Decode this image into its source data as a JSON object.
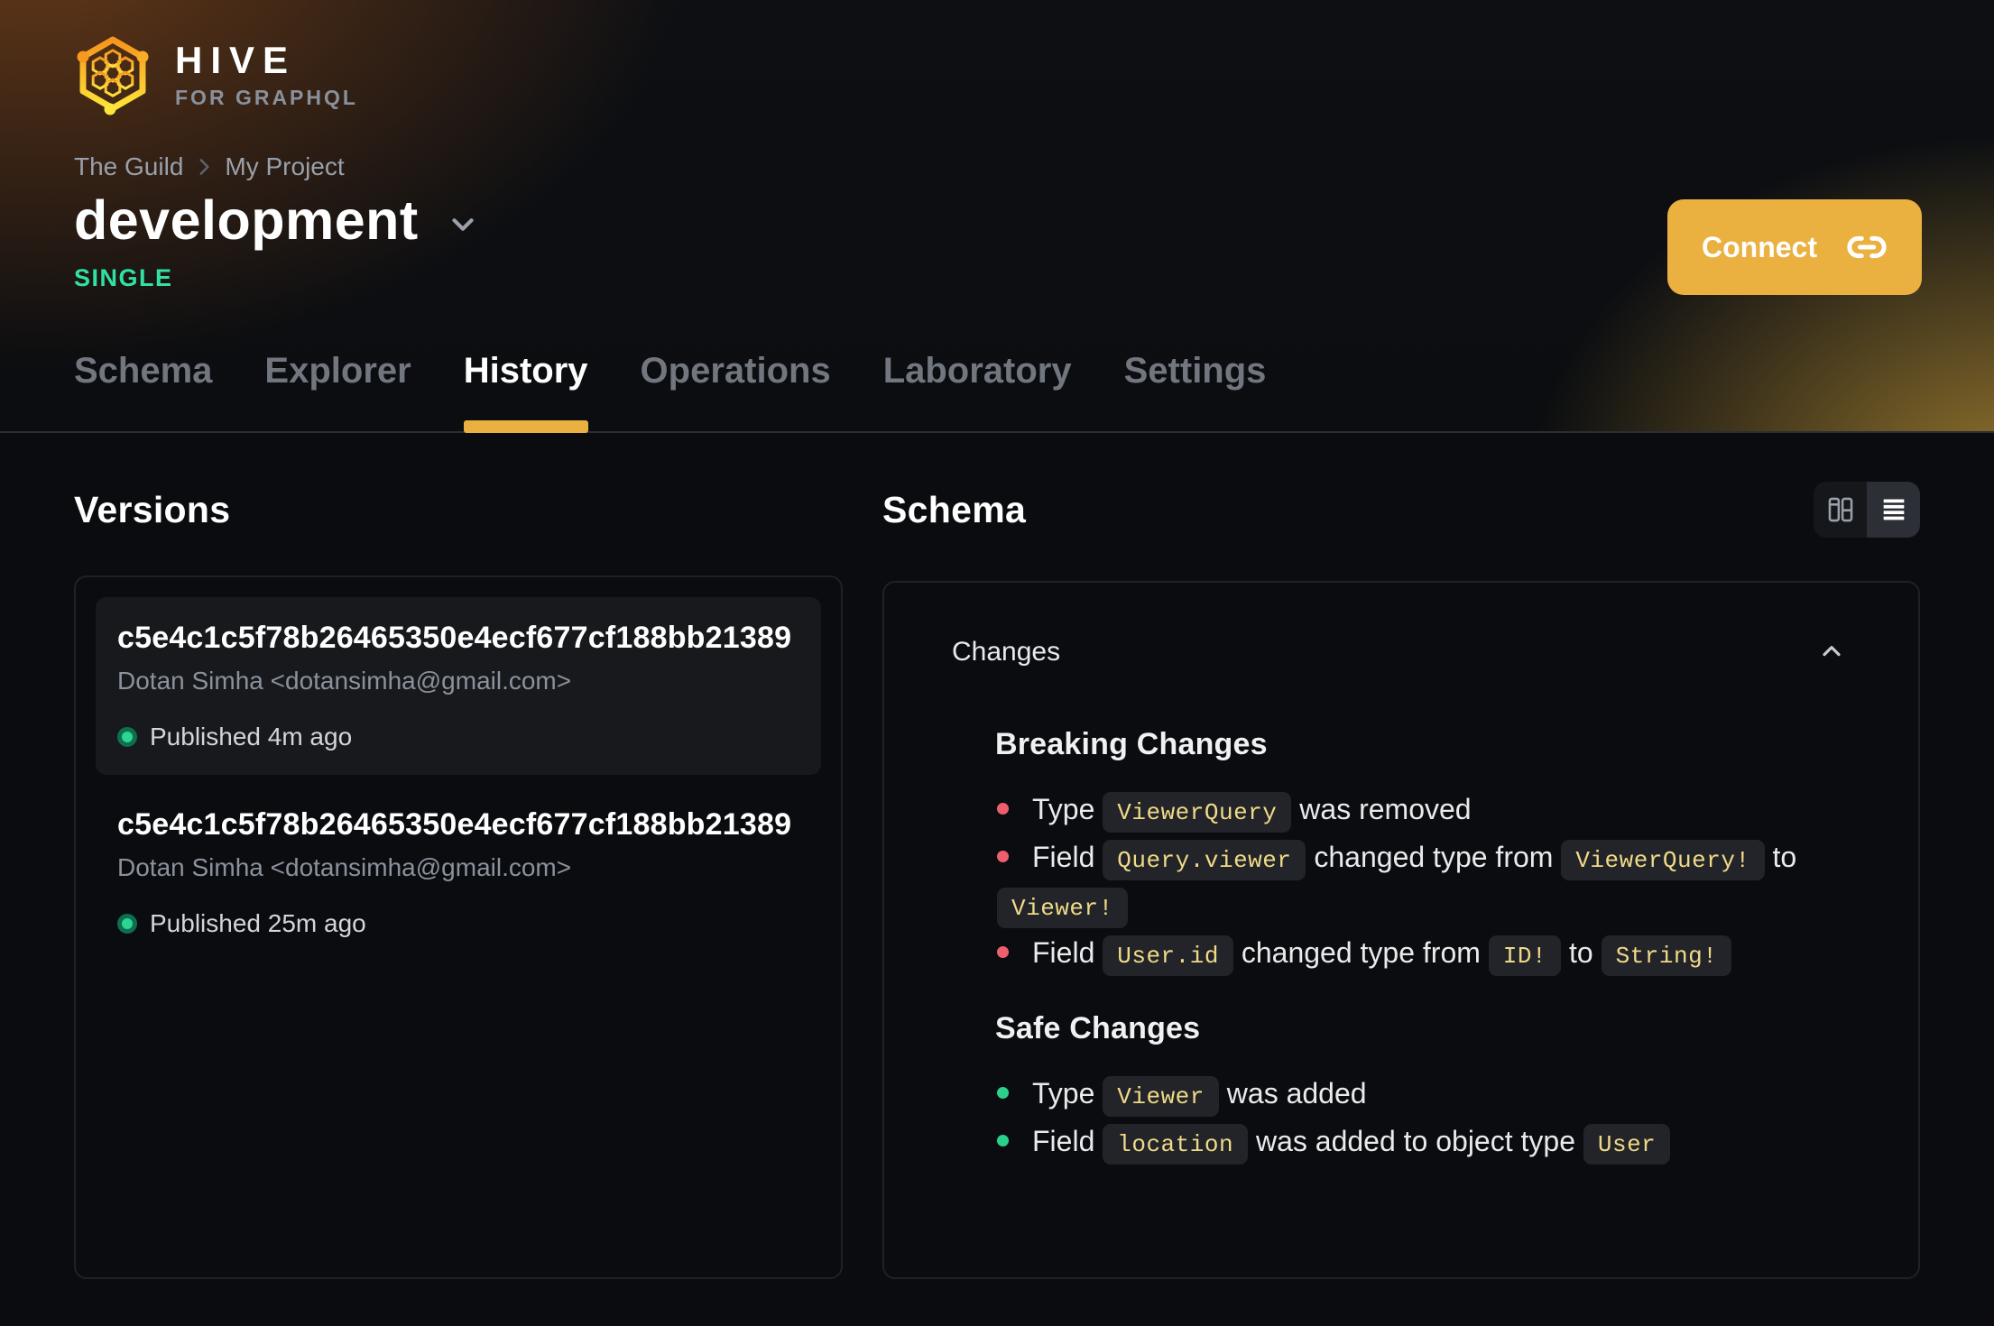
{
  "brand": {
    "name": "HIVE",
    "tagline": "FOR GRAPHQL"
  },
  "breadcrumb": [
    "The Guild",
    "My Project"
  ],
  "header": {
    "target_name": "development",
    "badge": "SINGLE",
    "connect_label": "Connect"
  },
  "tabs": [
    {
      "label": "Schema",
      "active": false
    },
    {
      "label": "Explorer",
      "active": false
    },
    {
      "label": "History",
      "active": true
    },
    {
      "label": "Operations",
      "active": false
    },
    {
      "label": "Laboratory",
      "active": false
    },
    {
      "label": "Settings",
      "active": false
    }
  ],
  "versions": {
    "title": "Versions",
    "items": [
      {
        "hash": "c5e4c1c5f78b26465350e4ecf677cf188bb21389",
        "author": "Dotan Simha <dotansimha@gmail.com>",
        "status": "Published 4m ago",
        "selected": true
      },
      {
        "hash": "c5e4c1c5f78b26465350e4ecf677cf188bb21389",
        "author": "Dotan Simha <dotansimha@gmail.com>",
        "status": "Published 25m ago",
        "selected": false
      }
    ]
  },
  "schema_panel": {
    "title": "Schema",
    "section_label": "Changes",
    "view_toggle": [
      "columns-view",
      "list-view"
    ],
    "active_view": "list-view",
    "sections": [
      {
        "kind": "breaking",
        "title": "Breaking Changes",
        "items": [
          [
            {
              "t": "text",
              "v": "Type "
            },
            {
              "t": "code",
              "v": "ViewerQuery"
            },
            {
              "t": "text",
              "v": " was removed"
            }
          ],
          [
            {
              "t": "text",
              "v": "Field "
            },
            {
              "t": "code",
              "v": "Query.viewer"
            },
            {
              "t": "text",
              "v": " changed type from "
            },
            {
              "t": "code",
              "v": "ViewerQuery!"
            },
            {
              "t": "text",
              "v": " to "
            },
            {
              "t": "code",
              "v": "Viewer!"
            }
          ],
          [
            {
              "t": "text",
              "v": "Field "
            },
            {
              "t": "code",
              "v": "User.id"
            },
            {
              "t": "text",
              "v": " changed type from "
            },
            {
              "t": "code",
              "v": "ID!"
            },
            {
              "t": "text",
              "v": " to "
            },
            {
              "t": "code",
              "v": "String!"
            }
          ]
        ]
      },
      {
        "kind": "safe",
        "title": "Safe Changes",
        "items": [
          [
            {
              "t": "text",
              "v": "Type "
            },
            {
              "t": "code",
              "v": "Viewer"
            },
            {
              "t": "text",
              "v": " was added"
            }
          ],
          [
            {
              "t": "text",
              "v": "Field "
            },
            {
              "t": "code",
              "v": "location"
            },
            {
              "t": "text",
              "v": " was added to object type "
            },
            {
              "t": "code",
              "v": "User"
            }
          ]
        ]
      }
    ]
  },
  "colors": {
    "accent": "#eab040",
    "badge": "#31e1a4",
    "breaking": "#ee5f6c",
    "safe": "#2bd08d",
    "chip_text": "#f0da88",
    "chip_bg": "#222429",
    "published_dot": "#2dd492"
  }
}
